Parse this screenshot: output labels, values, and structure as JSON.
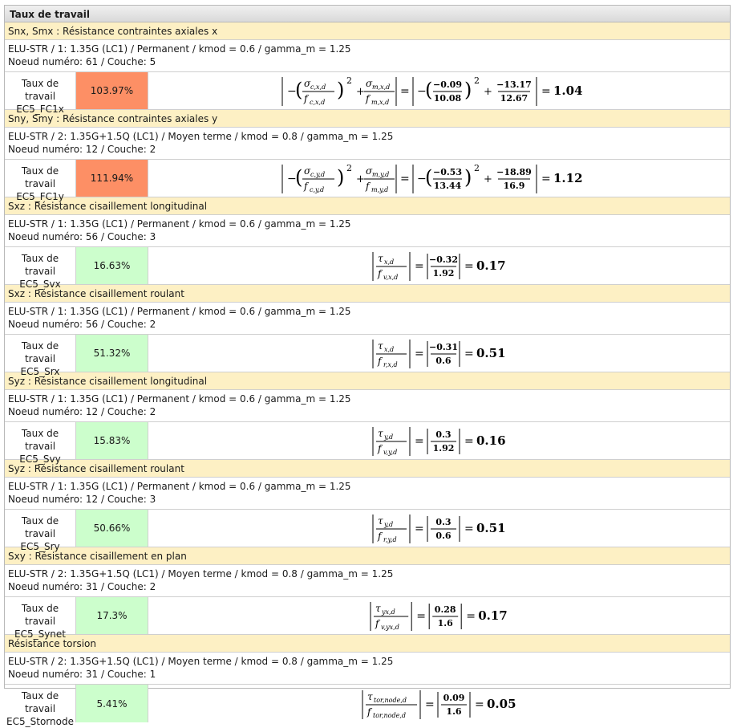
{
  "header": {
    "title": "Taux de travail"
  },
  "colors": {
    "over_limit": "#fd8f65",
    "ok": "#ccfecc"
  },
  "sections": [
    {
      "title": "Snx, Smx : Résistance contraintes axiales x",
      "combo": "ELU-STR / 1: 1.35G (LC1) / Permanent / kmod = 0.6 / gamma_m = 1.25",
      "node": "Noeud numéro: 61 / Couche: 5",
      "label_line1": "Taux de travail",
      "label_line2": "EC5_FC1x",
      "rate": "103.97%",
      "status": "over_limit",
      "formula": {
        "type": "axial",
        "sym_s1": "σ",
        "sub_s1": "c,x,d",
        "sym_f1": "f",
        "sub_f1": "c,x,d",
        "sym_s2": "σ",
        "sub_s2": "m,x,d",
        "sym_f2": "f",
        "sub_f2": "m,x,d",
        "n1": "−0.09",
        "d1": "10.08",
        "n2": "−13.17",
        "d2": "12.67",
        "sign_minus": "−",
        "plus": "+",
        "exponent": "2",
        "eq": "=",
        "result": "1.04"
      }
    },
    {
      "title": "Sny, Smy : Résistance contraintes axiales y",
      "combo": "ELU-STR / 2: 1.35G+1.5Q (LC1) / Moyen terme / kmod = 0.8 / gamma_m = 1.25",
      "node": "Noeud numéro: 12 / Couche: 2",
      "label_line1": "Taux de travail",
      "label_line2": "EC5_FC1y",
      "rate": "111.94%",
      "status": "over_limit",
      "formula": {
        "type": "axial",
        "sym_s1": "σ",
        "sub_s1": "c,y,d",
        "sym_f1": "f",
        "sub_f1": "c,y,d",
        "sym_s2": "σ",
        "sub_s2": "m,y,d",
        "sym_f2": "f",
        "sub_f2": "m,y,d",
        "n1": "−0.53",
        "d1": "13.44",
        "n2": "−18.89",
        "d2": "16.9",
        "sign_minus": "−",
        "plus": "+",
        "exponent": "2",
        "eq": "=",
        "result": "1.12"
      }
    },
    {
      "title": "Sxz : Résistance cisaillement longitudinal",
      "combo": "ELU-STR / 1: 1.35G (LC1) / Permanent / kmod = 0.6 / gamma_m = 1.25",
      "node": "Noeud numéro: 56 / Couche: 3",
      "label_line1": "Taux de travail",
      "label_line2": "EC5_Svx",
      "rate": "16.63%",
      "status": "ok",
      "formula": {
        "type": "simple",
        "sym_top": "τ",
        "sub_top": "x,d",
        "sym_bot": "f",
        "sub_bot": "v,x,d",
        "num": "−0.32",
        "den": "1.92",
        "eq": "=",
        "result": "0.17"
      }
    },
    {
      "title": "Sxz : Résistance cisaillement roulant",
      "combo": "ELU-STR / 1: 1.35G (LC1) / Permanent / kmod = 0.6 / gamma_m = 1.25",
      "node": "Noeud numéro: 56 / Couche: 2",
      "label_line1": "Taux de travail",
      "label_line2": "EC5_Srx",
      "rate": "51.32%",
      "status": "ok",
      "formula": {
        "type": "simple",
        "sym_top": "τ",
        "sub_top": "x,d",
        "sym_bot": "f",
        "sub_bot": "r,x,d",
        "num": "−0.31",
        "den": "0.6",
        "eq": "=",
        "result": "0.51"
      }
    },
    {
      "title": "Syz : Résistance cisaillement longitudinal",
      "combo": "ELU-STR / 1: 1.35G (LC1) / Permanent / kmod = 0.6 / gamma_m = 1.25",
      "node": "Noeud numéro: 12 / Couche: 2",
      "label_line1": "Taux de travail",
      "label_line2": "EC5_Svy",
      "rate": "15.83%",
      "status": "ok",
      "formula": {
        "type": "simple",
        "sym_top": "τ",
        "sub_top": "y,d",
        "sym_bot": "f",
        "sub_bot": "v,y,d",
        "num": "0.3",
        "den": "1.92",
        "eq": "=",
        "result": "0.16"
      }
    },
    {
      "title": "Syz : Résistance cisaillement roulant",
      "combo": "ELU-STR / 1: 1.35G (LC1) / Permanent / kmod = 0.6 / gamma_m = 1.25",
      "node": "Noeud numéro: 12 / Couche: 3",
      "label_line1": "Taux de travail",
      "label_line2": "EC5_Sry",
      "rate": "50.66%",
      "status": "ok",
      "formula": {
        "type": "simple",
        "sym_top": "τ",
        "sub_top": "y,d",
        "sym_bot": "f",
        "sub_bot": "r,y,d",
        "num": "0.3",
        "den": "0.6",
        "eq": "=",
        "result": "0.51"
      }
    },
    {
      "title": "Sxy : Résistance cisaillement en plan",
      "combo": "ELU-STR / 2: 1.35G+1.5Q (LC1) / Moyen terme / kmod = 0.8 / gamma_m = 1.25",
      "node": "Noeud numéro: 31 / Couche: 2",
      "label_line1": "Taux de travail",
      "label_line2": "EC5_Synet",
      "rate": "17.3%",
      "status": "ok",
      "formula": {
        "type": "simple",
        "sym_top": "τ",
        "sub_top": "yx,d",
        "sym_bot": "f",
        "sub_bot": "v,yx,d",
        "num": "0.28",
        "den": "1.6",
        "eq": "=",
        "result": "0.17"
      }
    },
    {
      "title": "Résistance torsion",
      "combo": "ELU-STR / 2: 1.35G+1.5Q (LC1) / Moyen terme / kmod = 0.8 / gamma_m = 1.25",
      "node": "Noeud numéro: 31 / Couche: 1",
      "label_line1": "Taux de travail",
      "label_line2": "EC5_Stornode",
      "rate": "5.41%",
      "status": "ok",
      "formula": {
        "type": "simple",
        "sym_top": "τ",
        "sub_top": "tor,node,d",
        "sym_bot": "f",
        "sub_bot": "tor,node,d",
        "num": "0.09",
        "den": "1.6",
        "eq": "=",
        "result": "0.05"
      }
    }
  ]
}
